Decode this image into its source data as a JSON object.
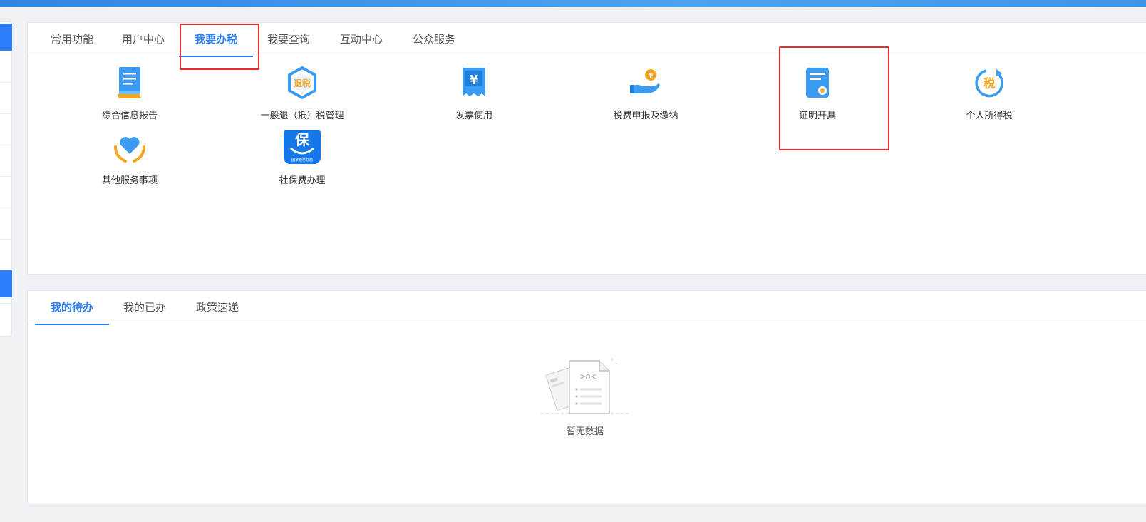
{
  "tabs_top": [
    {
      "label": "常用功能"
    },
    {
      "label": "用户中心"
    },
    {
      "label": "我要办税"
    },
    {
      "label": "我要查询"
    },
    {
      "label": "互动中心"
    },
    {
      "label": "公众服务"
    }
  ],
  "tax_functions": [
    {
      "label": "综合信息报告",
      "icon": "document-report-icon"
    },
    {
      "label": "一般退（抵）税管理",
      "icon": "tax-refund-icon",
      "icon_text": "退税"
    },
    {
      "label": "发票使用",
      "icon": "invoice-icon",
      "icon_text": "¥"
    },
    {
      "label": "税费申报及缴纳",
      "icon": "hand-coin-icon",
      "icon_text": "¥"
    },
    {
      "label": "证明开具",
      "icon": "certificate-icon"
    },
    {
      "label": "个人所得税",
      "icon": "personal-tax-icon",
      "icon_text": "税"
    },
    {
      "label": "其他服务事项",
      "icon": "heart-hands-icon"
    },
    {
      "label": "社保费办理",
      "icon": "social-security-icon",
      "icon_text": "保",
      "icon_subtext": "国家税务总局"
    }
  ],
  "tabs_bottom": [
    {
      "label": "我的待办"
    },
    {
      "label": "我的已办"
    },
    {
      "label": "政策速递"
    }
  ],
  "empty_state": {
    "text": "暂无数据",
    "illustration_text": ">o<"
  },
  "colors": {
    "accent": "#2d7ff9",
    "highlight_box": "#e52b2b",
    "icon_blue": "#3a9bf0",
    "icon_orange": "#f5a623"
  }
}
